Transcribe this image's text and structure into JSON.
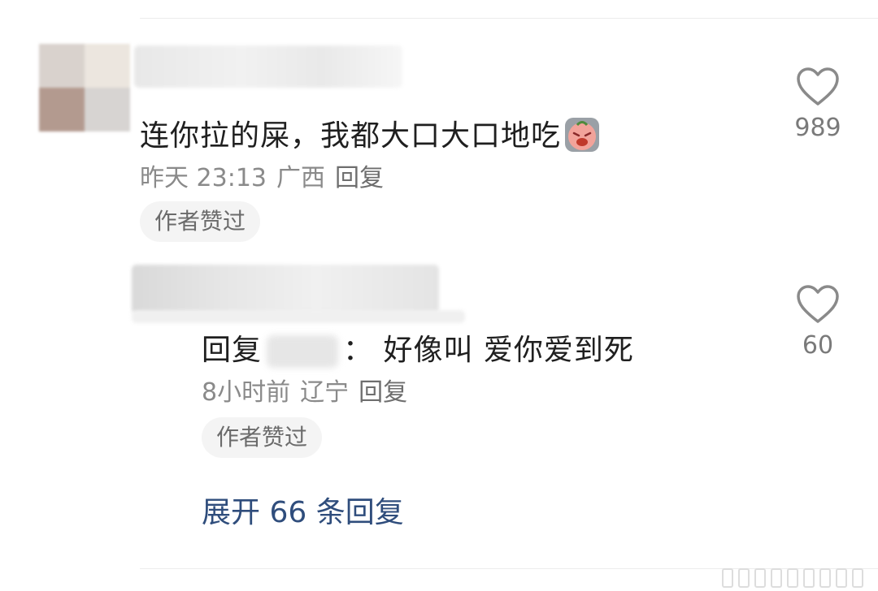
{
  "comments": [
    {
      "text": "连你拉的屎，我都大口大口地吃",
      "emoji": "crying-face-emoji",
      "time": "昨天 23:13",
      "location": "广西",
      "reply_label": "回复",
      "author_badge": "作者赞过",
      "likes": "989"
    },
    {
      "reply_prefix": "回复",
      "text": "：  好像叫 爱你爱到死",
      "time": "8小时前",
      "location": "辽宁",
      "reply_label": "回复",
      "author_badge": "作者赞过",
      "likes": "60"
    }
  ],
  "expand_label": "展开 66 条回复",
  "colors": {
    "link": "#2f4d7c",
    "meta": "#8a8a8a",
    "badge_bg": "#f4f4f4"
  }
}
